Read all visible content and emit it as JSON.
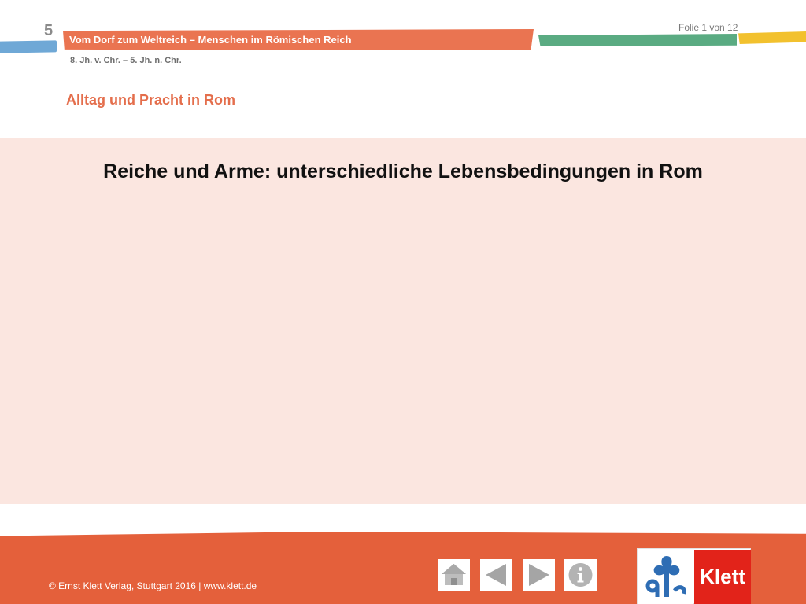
{
  "header": {
    "chapter_number": "5",
    "chapter_title": "Vom Dorf zum Weltreich – Menschen im Römischen Reich",
    "period": "8. Jh. v. Chr. – 5. Jh. n. Chr.",
    "slide_counter": "Folie 1 von 12",
    "section_title": "Alltag und Pracht in Rom"
  },
  "main": {
    "heading": "Reiche und Arme: unterschiedliche Lebensbedingungen in Rom"
  },
  "footer": {
    "copyright": "© Ernst Klett Verlag, Stuttgart 2016 | www.klett.de",
    "nav": [
      {
        "icon": "home-icon"
      },
      {
        "icon": "arrow-left-icon"
      },
      {
        "icon": "arrow-right-icon"
      },
      {
        "icon": "info-icon"
      }
    ],
    "logo_text": "Klett"
  },
  "colors": {
    "accent": "#ea7451",
    "footer": "#e4603b",
    "content_bg": "#fbe6e0",
    "brand_red": "#e2231a",
    "stripe_blue": "#6fa8d6",
    "stripe_green": "#5aab82",
    "stripe_yellow": "#f2c12e"
  }
}
